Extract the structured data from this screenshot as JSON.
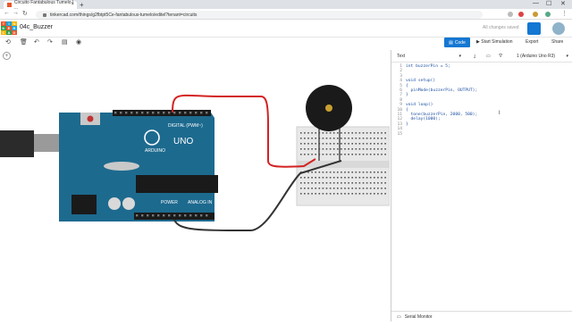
{
  "browser": {
    "tab_title": "Circuito Fantabulous Tumelo | ...",
    "new_tab": "+",
    "url": "tinkercad.com/things/g2fbtpt5Ce-fantabulous-tumelo/editel?tenant=circuits",
    "window_controls": [
      "—",
      "☐",
      "✕"
    ]
  },
  "app": {
    "logo_letters": [
      "T",
      "I",
      "N",
      "K",
      "E",
      "R",
      "C",
      "A",
      "D"
    ],
    "logo_colors": [
      "#e8562a",
      "#1aa3d9",
      "#f4b400",
      "#2e9e4f",
      "#e8562a",
      "#1aa3d9",
      "#f4b400",
      "#2e9e4f",
      "#e8562a"
    ],
    "project_title": "04c_Buzzer",
    "save_status": "All changes saved"
  },
  "toolbar": {
    "code_label": "Code",
    "simulate_label": "Start Simulation",
    "export_label": "Export",
    "share_label": "Share"
  },
  "code_panel": {
    "mode": "Text",
    "board": "1 (Arduino Uno R3)",
    "line_numbers": "1\n2\n3\n4\n5\n6\n7\n8\n9\n10\n11\n12\n13\n14\n15",
    "code": "int buzzerPin = 5;\n\n\nvoid setup()\n{\n  pinMode(buzzerPin, OUTPUT);\n}\n\nvoid loop()\n{\n  tone(buzzerPin, 2000, 500);\n  delay(1000);\n}",
    "serial_monitor": "Serial Monitor"
  },
  "board_labels": {
    "digital": "DIGITAL (PWM~)",
    "uno": "UNO",
    "arduino": "ARDUINO",
    "power": "POWER",
    "analog": "ANALOG IN"
  },
  "colors": {
    "accent": "#1477d2",
    "board": "#1d6a8f",
    "wire_red": "#d32323",
    "wire_black": "#333333",
    "buzzer": "#1a1a1a"
  }
}
